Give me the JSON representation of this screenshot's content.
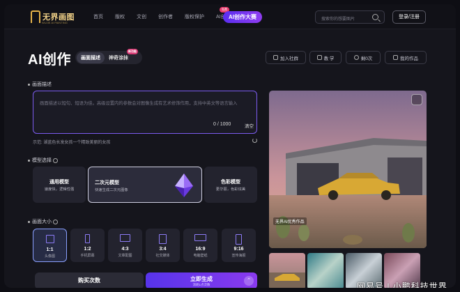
{
  "logo": {
    "name": "无界画图",
    "tagline": "WUJIE AI PAINTING"
  },
  "nav": {
    "items": [
      "首页",
      "版权",
      "文创",
      "创作者",
      "版权保护",
      "AI创作"
    ],
    "ai_badge": "免费",
    "contest": "AI创作大赛"
  },
  "search": {
    "placeholder": "搜索你的想要图片"
  },
  "login": "登录/注册",
  "page": {
    "title": "AI创作",
    "mode_tabs": [
      "画面描述",
      "神奇涂抹"
    ],
    "mode_badge": "新功能"
  },
  "toolbar": {
    "community": "加入社群",
    "tutorial": "教 学",
    "remaining": "剩0次",
    "my_works": "我的作品"
  },
  "prompt": {
    "section": "画面描述",
    "placeholder": "画面描述以短句、短语为佳。高级设置内的参数会对图像生成有艺术修饰作用，支持中英文等语言输入",
    "count": "0 / 1000",
    "clear": "清空",
    "hint": "示范: 湖蓝色长发女孩一个精致美丽的女孩"
  },
  "models": {
    "section": "模型选择",
    "items": [
      {
        "name": "通用模型",
        "desc": "速度快，逻辑性强"
      },
      {
        "name": "二次元模型",
        "desc": "快速生成二次元图像"
      },
      {
        "name": "色彩模型",
        "desc": "更华丽，色彩炫美"
      }
    ]
  },
  "ratios": {
    "section": "画面大小",
    "items": [
      {
        "ratio": "1:1",
        "use": "头像图"
      },
      {
        "ratio": "1:2",
        "use": "手机屏幕"
      },
      {
        "ratio": "4:3",
        "use": "文章配图"
      },
      {
        "ratio": "3:4",
        "use": "社交媒体"
      },
      {
        "ratio": "16:9",
        "use": "电脑壁纸"
      },
      {
        "ratio": "9:16",
        "use": "宣传海报"
      }
    ]
  },
  "actions": {
    "buy": "购买次数",
    "generate": "立即生成",
    "generate_sub": "消耗1点次数"
  },
  "preview": {
    "tag": "无界AI优秀作品"
  },
  "watermark": "网易号 | 小鹏科技世界",
  "colors": {
    "accent": "#6c3cf0",
    "selected_border": "#7c5cf0",
    "car": "#d8a834"
  }
}
